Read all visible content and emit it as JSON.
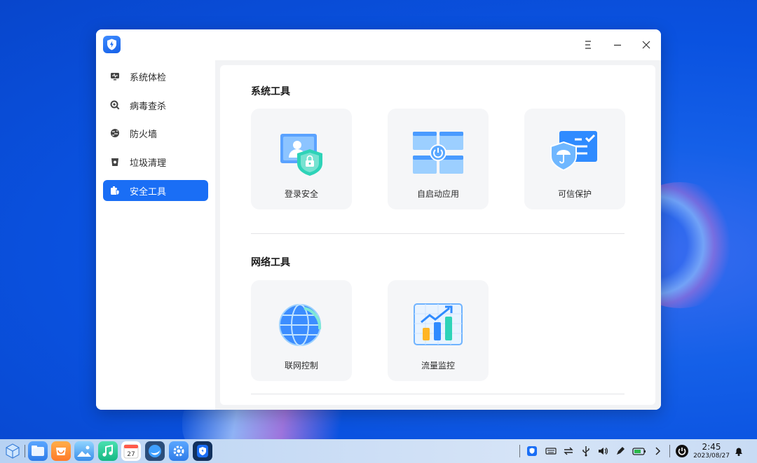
{
  "window": {
    "controls": {
      "menu": "menu-icon",
      "minimize": "minimize-icon",
      "close": "close-icon"
    }
  },
  "sidebar": {
    "items": [
      {
        "label": "系统体检",
        "icon": "monitor-icon"
      },
      {
        "label": "病毒查杀",
        "icon": "virus-scan-icon"
      },
      {
        "label": "防火墙",
        "icon": "firewall-icon"
      },
      {
        "label": "垃圾清理",
        "icon": "trash-icon"
      },
      {
        "label": "安全工具",
        "icon": "toolbox-icon",
        "active": true
      }
    ]
  },
  "main": {
    "sections": [
      {
        "title": "系统工具",
        "tools": [
          {
            "label": "登录安全",
            "icon": "login-security-icon"
          },
          {
            "label": "自启动应用",
            "icon": "autostart-apps-icon"
          },
          {
            "label": "可信保护",
            "icon": "trusted-protection-icon"
          }
        ]
      },
      {
        "title": "网络工具",
        "tools": [
          {
            "label": "联网控制",
            "icon": "network-control-icon"
          },
          {
            "label": "流量监控",
            "icon": "traffic-monitor-icon"
          }
        ]
      }
    ]
  },
  "taskbar": {
    "calendar_day": "27",
    "time": "2:45",
    "date": "2023/08/27"
  },
  "colors": {
    "accent": "#1a6ef5",
    "desktop": "#0a52e0"
  }
}
